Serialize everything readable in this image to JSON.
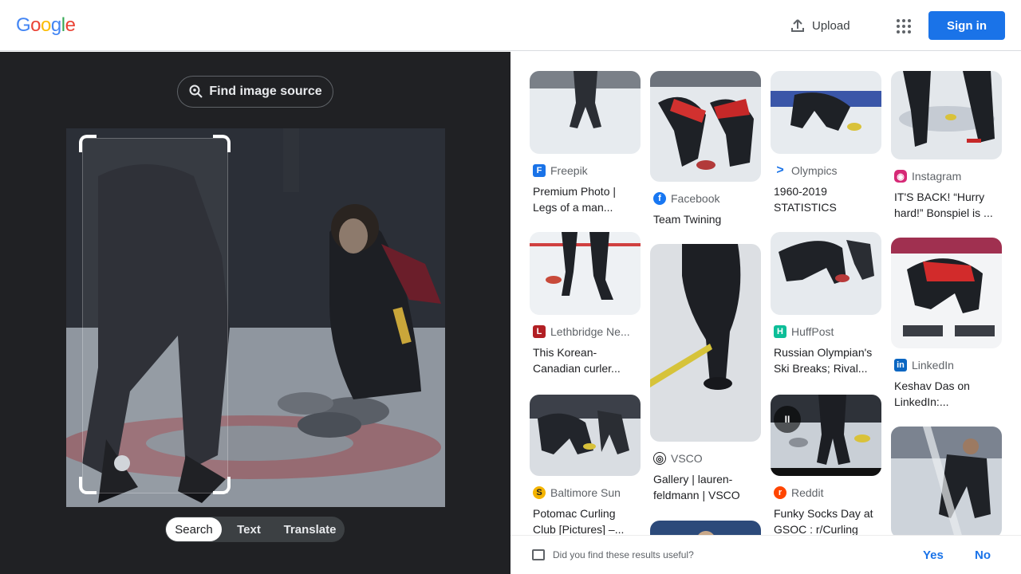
{
  "header": {
    "logo_letters": [
      "G",
      "o",
      "o",
      "g",
      "l",
      "e"
    ],
    "logo_colors": [
      "#4285f4",
      "#ea4335",
      "#fbbc05",
      "#4285f4",
      "#34a853",
      "#ea4335"
    ],
    "upload_label": "Upload",
    "signin_label": "Sign in"
  },
  "lens": {
    "find_source_label": "Find image source",
    "tabs": [
      {
        "label": "Search",
        "active": true
      },
      {
        "label": "Text",
        "active": false
      },
      {
        "label": "Translate",
        "active": false
      }
    ]
  },
  "results": [
    {
      "source": "Freepik",
      "title": "Premium Photo | Legs of a man..."
    },
    {
      "source": "Facebook",
      "title": "Team Twining"
    },
    {
      "source": "Olympics",
      "title": "1960-2019 STATISTICS"
    },
    {
      "source": "Instagram",
      "title": "IT'S BACK! “Hurry hard!” Bonspiel is ..."
    },
    {
      "source": "Lethbridge Ne...",
      "title": "This Korean-Canadian curler..."
    },
    {
      "source": "VSCO",
      "title": "Gallery | lauren-feldmann | VSCO"
    },
    {
      "source": "HuffPost",
      "title": "Russian Olympian's Ski Breaks; Rival..."
    },
    {
      "source": "LinkedIn",
      "title": "Keshav Das on LinkedIn:..."
    },
    {
      "source": "Baltimore Sun",
      "title": "Potomac Curling Club [Pictures] –..."
    },
    {
      "source": "Reddit",
      "title": "Funky Socks Day at GSOC : r/Curling"
    }
  ],
  "video_overlay": "II",
  "feedback": {
    "question": "Did you find these results useful?",
    "yes": "Yes",
    "no": "No"
  },
  "colors": {
    "accent": "#1a73e8",
    "dark_panel": "#202124"
  }
}
